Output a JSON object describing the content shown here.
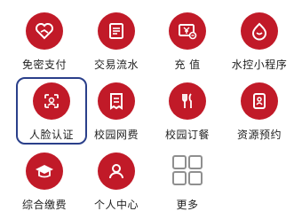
{
  "colors": {
    "accent": "#c11a28",
    "selected_border": "#2a3f8a",
    "text": "#222222"
  },
  "menu": {
    "items": [
      {
        "label": "免密支付",
        "icon": "heart-hand-icon"
      },
      {
        "label": "交易流水",
        "icon": "receipt-icon"
      },
      {
        "label": "充 值",
        "icon": "yen-card-icon"
      },
      {
        "label": "水控小程序",
        "icon": "water-drop-icon"
      },
      {
        "label": "人脸认证",
        "icon": "face-scan-icon",
        "selected": true
      },
      {
        "label": "校园网费",
        "icon": "network-bill-icon"
      },
      {
        "label": "校园订餐",
        "icon": "fork-knife-icon"
      },
      {
        "label": "资源预约",
        "icon": "resource-phone-icon"
      },
      {
        "label": "综合缴费",
        "icon": "graduation-cap-icon"
      },
      {
        "label": "个人中心",
        "icon": "user-icon"
      },
      {
        "label": "更多",
        "icon": "more-grid-icon"
      }
    ]
  }
}
